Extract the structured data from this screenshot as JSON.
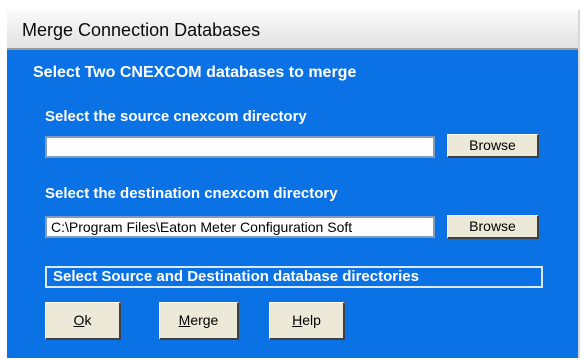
{
  "window": {
    "title": "Merge Connection Databases",
    "heading": "Select Two CNEXCOM databases to merge",
    "source": {
      "label": "Select the source cnexcom directory",
      "value": "",
      "browse": "Browse"
    },
    "destination": {
      "label": "Select the destination cnexcom directory",
      "value": "C:\\Program Files\\Eaton Meter Configuration Soft",
      "browse": "Browse"
    },
    "status": "Select Source and Destination database directories",
    "buttons": {
      "ok": {
        "first": "O",
        "rest": "k"
      },
      "merge": {
        "first": "M",
        "rest": "erge"
      },
      "help": {
        "first": "H",
        "rest": "elp"
      }
    }
  },
  "colors": {
    "dialog_background": "#0a72e4",
    "titlebar": "#eeeeee",
    "button_face": "#ece9d8"
  }
}
